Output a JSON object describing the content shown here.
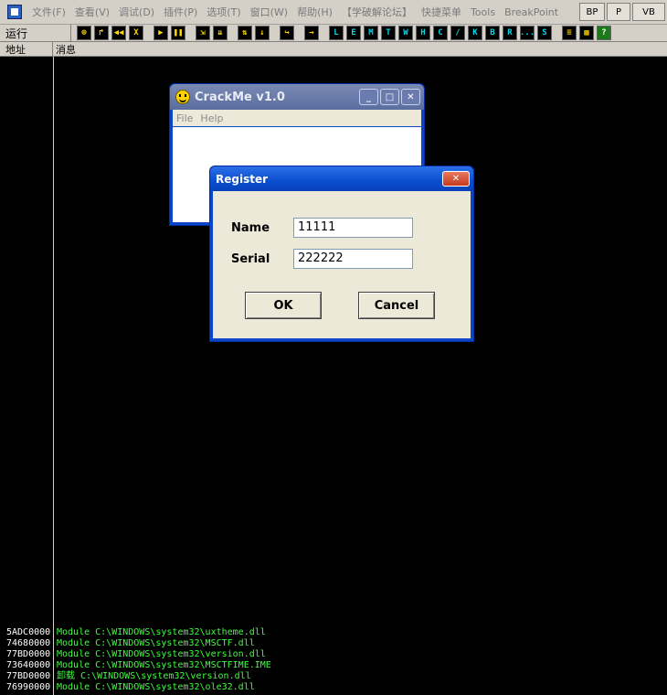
{
  "menubar": {
    "items": [
      "文件(F)",
      "查看(V)",
      "调试(D)",
      "插件(P)",
      "选项(T)",
      "窗口(W)",
      "帮助(H)",
      "【学破解论坛】",
      "快捷菜单",
      "Tools",
      "BreakPoint"
    ],
    "right_buttons": [
      "BP",
      "P",
      "VB"
    ]
  },
  "toolbar": {
    "status": "运行",
    "buttons": [
      "⊕",
      "↱",
      "◀◀",
      "X",
      "▶",
      "❚❚",
      "⇲",
      "⇊",
      "⇅",
      "↓",
      "↪",
      "→",
      "L",
      "E",
      "M",
      "T",
      "W",
      "H",
      "C",
      "/",
      "K",
      "B",
      "R",
      "...",
      "S",
      "≡",
      "▦",
      "?"
    ]
  },
  "columns": {
    "address": "地址",
    "message": "消息"
  },
  "log": [
    {
      "addr": "5ADC0000",
      "msg": "Module C:\\WINDOWS\\system32\\uxtheme.dll"
    },
    {
      "addr": "74680000",
      "msg": "Module C:\\WINDOWS\\system32\\MSCTF.dll"
    },
    {
      "addr": "77BD0000",
      "msg": "Module C:\\WINDOWS\\system32\\version.dll"
    },
    {
      "addr": "73640000",
      "msg": "Module C:\\WINDOWS\\system32\\MSCTFIME.IME"
    },
    {
      "addr": "77BD0000",
      "msg": "卸载 C:\\WINDOWS\\system32\\version.dll"
    },
    {
      "addr": "76990000",
      "msg": "Module C:\\WINDOWS\\system32\\ole32.dll"
    }
  ],
  "crackme": {
    "title": "CrackMe v1.0",
    "menu": [
      "File",
      "Help"
    ],
    "win_buttons": [
      "_",
      "□",
      "✕"
    ]
  },
  "register": {
    "title": "Register",
    "close": "✕",
    "name_label": "Name",
    "name_value": "11111",
    "serial_label": "Serial",
    "serial_value": "222222",
    "ok": "OK",
    "cancel": "Cancel"
  }
}
